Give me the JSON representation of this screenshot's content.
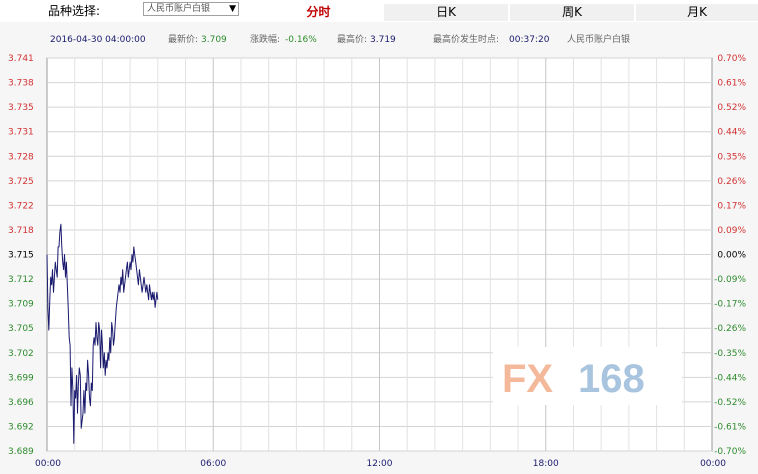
{
  "selector": {
    "label": "品种选择:",
    "value": "人民币账户白银",
    "arrow": "▼"
  },
  "tabs": [
    {
      "label": "分时",
      "active": true
    },
    {
      "label": "日K",
      "active": false
    },
    {
      "label": "周K",
      "active": false
    },
    {
      "label": "月K",
      "active": false
    }
  ],
  "info": {
    "datetime": "2016-04-30 04:00:00",
    "latest_label": "最新价:",
    "latest_value": "3.709",
    "change_label": "涨跌幅:",
    "change_value": "-0.16%",
    "high_label": "最高价:",
    "high_value": "3.719",
    "high_time_label": "最高价发生时点:",
    "high_time_value": "00:37:20",
    "product": "人民币账户白银"
  },
  "watermark": {
    "text_fx": "FX",
    "text_num": "168"
  },
  "colors": {
    "up": "#d23232",
    "down": "#2e8b2e",
    "flat": "#000000",
    "line": "#1a1a6e",
    "info_value": "#2e8b2e"
  },
  "chart_data": {
    "type": "line",
    "xlim_hours": [
      0,
      24
    ],
    "x_ticks": [
      "00:00",
      "06:00",
      "12:00",
      "18:00",
      "00:00"
    ],
    "ylim": [
      3.689,
      3.741
    ],
    "y_ticks_left": [
      "3.741",
      "3.738",
      "3.735",
      "3.731",
      "3.728",
      "3.725",
      "3.722",
      "3.718",
      "3.715",
      "3.712",
      "3.709",
      "3.705",
      "3.702",
      "3.699",
      "3.696",
      "3.692",
      "3.689"
    ],
    "y_ticks_right": [
      "0.70%",
      "0.61%",
      "0.52%",
      "0.44%",
      "0.35%",
      "0.26%",
      "0.17%",
      "0.09%",
      "0.00%",
      "-0.09%",
      "-0.17%",
      "-0.26%",
      "-0.35%",
      "-0.44%",
      "-0.52%",
      "-0.61%",
      "-0.70%"
    ],
    "grid": true,
    "series": [
      {
        "x": [
          "00:00",
          "00:02",
          "00:04",
          "00:06",
          "00:08",
          "00:10",
          "00:12",
          "00:14",
          "00:16",
          "00:18",
          "00:20",
          "00:22",
          "00:24",
          "00:26",
          "00:28",
          "00:30",
          "00:32",
          "00:34",
          "00:36",
          "00:38",
          "00:40",
          "00:42",
          "00:44",
          "00:46",
          "00:48",
          "00:50",
          "00:52",
          "00:54",
          "00:56",
          "00:58",
          "01:00",
          "01:02",
          "01:04",
          "01:06",
          "01:08",
          "01:10",
          "01:12",
          "01:14",
          "01:16",
          "01:18",
          "01:20",
          "01:22",
          "01:24",
          "01:26",
          "01:28",
          "01:30",
          "01:32",
          "01:34",
          "01:36",
          "01:38",
          "01:40",
          "01:42",
          "01:44",
          "01:46",
          "01:48",
          "01:50",
          "01:52",
          "01:54",
          "01:56",
          "01:58",
          "02:00",
          "02:02",
          "02:04",
          "02:06",
          "02:08",
          "02:10",
          "02:12",
          "02:14",
          "02:16",
          "02:18",
          "02:20",
          "02:22",
          "02:24",
          "02:26",
          "02:28",
          "02:30",
          "02:32",
          "02:34",
          "02:36",
          "02:38",
          "02:40",
          "02:42",
          "02:44",
          "02:46",
          "02:48",
          "02:50",
          "02:52",
          "02:54",
          "02:56",
          "02:58",
          "03:00",
          "03:02",
          "03:04",
          "03:06",
          "03:08",
          "03:10",
          "03:12",
          "03:14",
          "03:16",
          "03:18",
          "03:20",
          "03:22",
          "03:24",
          "03:26",
          "03:28",
          "03:30",
          "03:32",
          "03:34",
          "03:36",
          "03:38",
          "03:40",
          "03:42",
          "03:44",
          "03:46",
          "03:48",
          "03:50",
          "03:52",
          "03:54",
          "03:56",
          "03:58",
          "04:00"
        ],
        "values": [
          3.715,
          3.708,
          3.705,
          3.709,
          3.712,
          3.711,
          3.713,
          3.71,
          3.712,
          3.714,
          3.713,
          3.712,
          3.716,
          3.716,
          3.718,
          3.719,
          3.716,
          3.714,
          3.713,
          3.715,
          3.712,
          3.714,
          3.711,
          3.708,
          3.704,
          3.703,
          3.695,
          3.7,
          3.697,
          3.69,
          3.697,
          3.696,
          3.699,
          3.694,
          3.698,
          3.7,
          3.699,
          3.692,
          3.693,
          3.694,
          3.697,
          3.694,
          3.698,
          3.697,
          3.701,
          3.699,
          3.696,
          3.695,
          3.698,
          3.697,
          3.703,
          3.704,
          3.703,
          3.706,
          3.704,
          3.703,
          3.706,
          3.705,
          3.7,
          3.705,
          3.703,
          3.7,
          3.702,
          3.699,
          3.701,
          3.7,
          3.702,
          3.701,
          3.704,
          3.702,
          3.706,
          3.705,
          3.703,
          3.704,
          3.706,
          3.708,
          3.709,
          3.71,
          3.711,
          3.71,
          3.712,
          3.711,
          3.713,
          3.71,
          3.711,
          3.712,
          3.713,
          3.714,
          3.712,
          3.713,
          3.714,
          3.713,
          3.715,
          3.714,
          3.716,
          3.715,
          3.714,
          3.713,
          3.712,
          3.711,
          3.713,
          3.712,
          3.711,
          3.71,
          3.711,
          3.712,
          3.711,
          3.71,
          3.711,
          3.71,
          3.709,
          3.711,
          3.71,
          3.709,
          3.71,
          3.709,
          3.71,
          3.708,
          3.709,
          3.71,
          3.709
        ]
      }
    ]
  }
}
